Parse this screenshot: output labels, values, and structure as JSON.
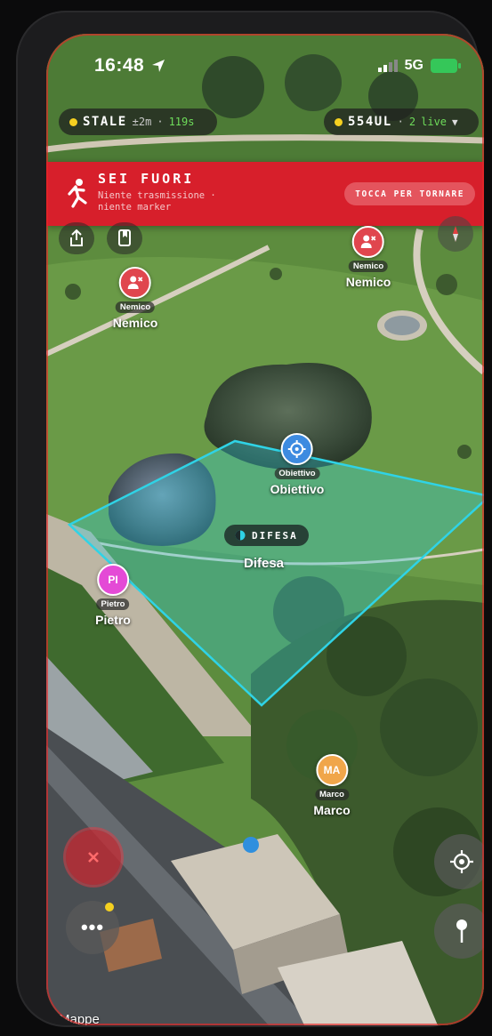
{
  "status_bar": {
    "time": "16:48",
    "network": "5G"
  },
  "status_pills": {
    "left": {
      "label": "STALE",
      "age": "±2m",
      "count": "119s"
    },
    "right": {
      "label": "554UL",
      "live_count": "2",
      "live_label": "live"
    }
  },
  "alert_banner": {
    "title": "SEI FUORI",
    "subtitle": "Niente trasmissione · niente marker",
    "action": "TOCCA PER TORNARE"
  },
  "markers": [
    {
      "tag": "Nemico",
      "name": "Nemico",
      "color": "#e0464e",
      "icon": "enemy-person-icon"
    },
    {
      "tag": "Nemico",
      "name": "Nemico",
      "color": "#e0464e",
      "icon": "enemy-person-icon"
    },
    {
      "tag": "Obiettivo",
      "name": "Obiettivo",
      "color": "#3d8be0",
      "icon": "target-icon"
    },
    {
      "initials": "PI",
      "tag": "Pietro",
      "name": "Pietro",
      "color": "#e44ad6"
    },
    {
      "initials": "MA",
      "tag": "Marco",
      "name": "Marco",
      "color": "#f0a64a"
    }
  ],
  "zone": {
    "pill_label": "DIFESA",
    "name": "Difesa",
    "color": "#2fd3e6"
  },
  "map": {
    "attribution": "Mappe"
  },
  "colors": {
    "alert": "#d71f2b",
    "stale": "#f5d020",
    "live": "#6edc5a"
  }
}
